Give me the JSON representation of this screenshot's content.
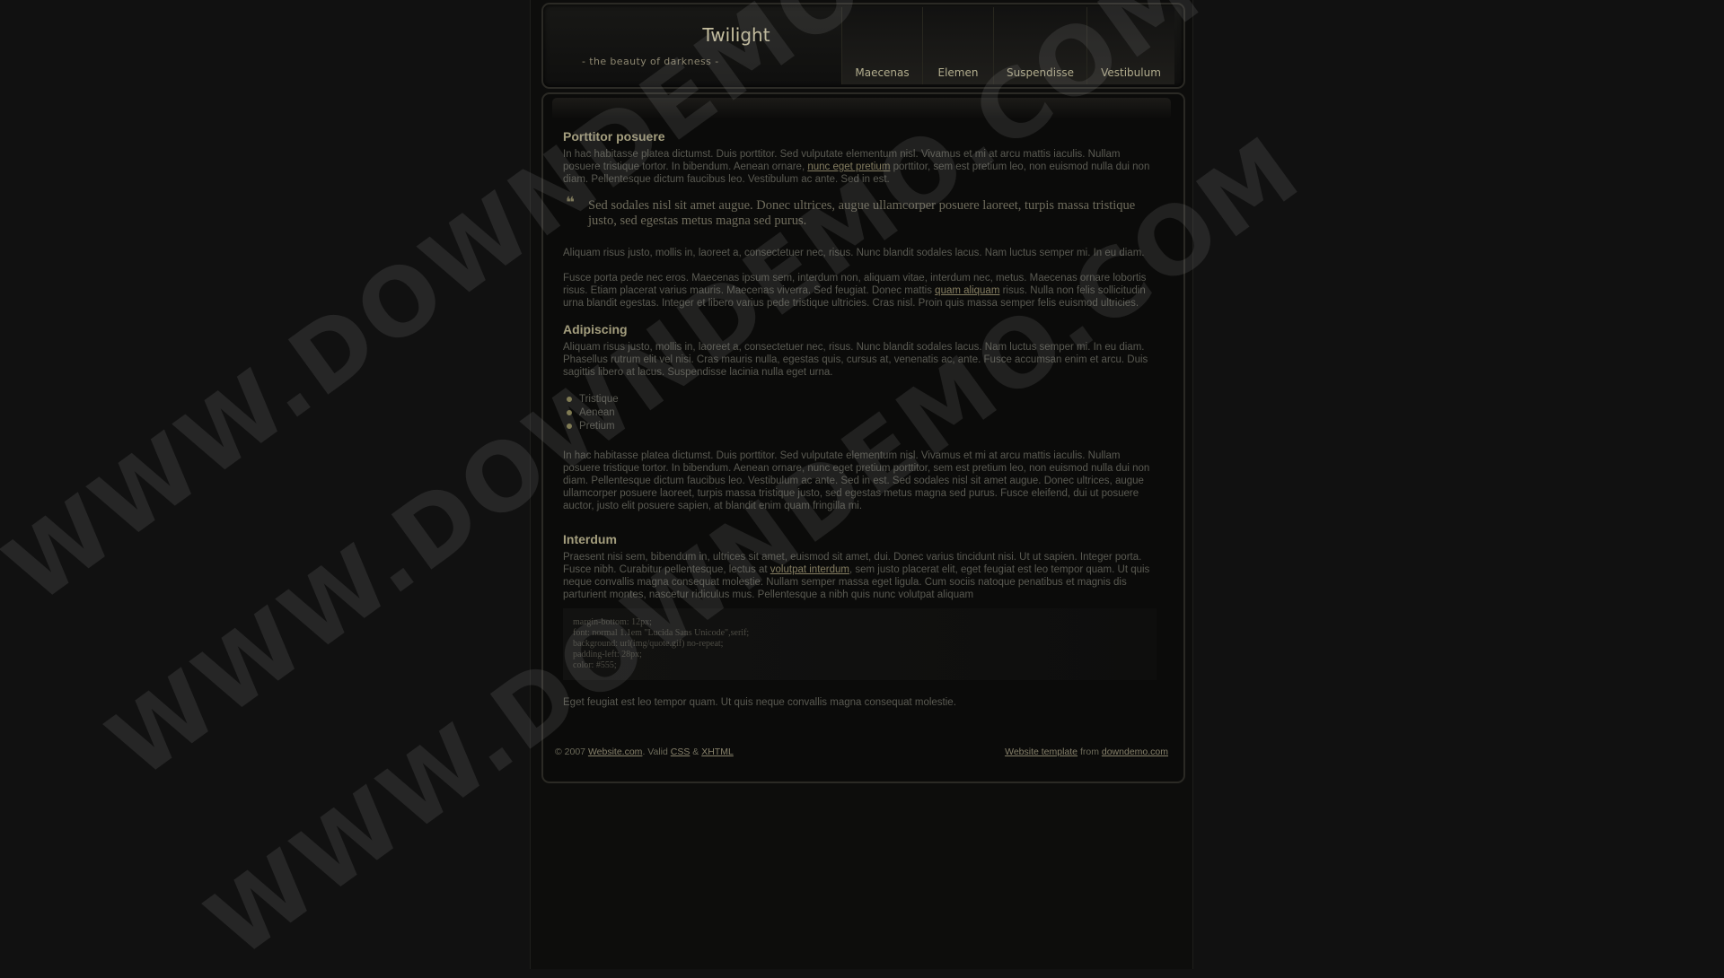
{
  "site": {
    "title": "Twilight",
    "tagline": "- the beauty of darkness -"
  },
  "nav": {
    "items": [
      "Maecenas",
      "Elemen",
      "Suspendisse",
      "Vestibulum"
    ]
  },
  "content": {
    "section1": {
      "heading": "Porttitor posuere",
      "p1_before": "In hac habitasse platea dictumst. Duis porttitor. Sed vulputate elementum nisl. Vivamus et mi at arcu mattis iaculis. Nullam posuere tristique tortor. In bibendum. Aenean ornare, ",
      "p1_link": "nunc eget pretium",
      "p1_after": " porttitor, sem est pretium leo, non euismod nulla dui non diam. Pellentesque dictum faucibus leo. Vestibulum ac ante. Sed in est.",
      "quote": "Sed sodales nisl sit amet augue. Donec ultrices, augue ullamcorper posuere laoreet, turpis massa tristique justo, sed egestas metus magna sed purus.",
      "p2": "Aliquam risus justo, mollis in, laoreet a, consectetuer nec, risus. Nunc blandit sodales lacus. Nam luctus semper mi. In eu diam.",
      "p3_before": "Fusce porta pede nec eros. Maecenas ipsum sem, interdum non, aliquam vitae, interdum nec, metus. Maecenas ornare lobortis risus. Etiam placerat varius mauris. Maecenas viverra. Sed feugiat. Donec mattis ",
      "p3_link": "quam aliquam",
      "p3_after": " risus. Nulla non felis sollicitudin urna blandit egestas. Integer et libero varius pede tristique ultricies. Cras nisl. Proin quis massa semper felis euismod ultricies."
    },
    "section2": {
      "heading": "Adipiscing",
      "p1": "Aliquam risus justo, mollis in, laoreet a, consectetuer nec, risus. Nunc blandit sodales lacus. Nam luctus semper mi. In eu diam. Phasellus rutrum elit vel nisi. Cras mauris nulla, egestas quis, cursus at, venenatis ac, ante. Fusce accumsan enim et arcu. Duis sagittis libero at lacus. Suspendisse lacinia nulla eget urna.",
      "bullets": [
        "Tristique",
        "Aenean",
        "Pretium"
      ],
      "p2": "In hac habitasse platea dictumst. Duis porttitor. Sed vulputate elementum nisl. Vivamus et mi at arcu mattis iaculis. Nullam posuere tristique tortor. In bibendum. Aenean ornare, nunc eget pretium porttitor, sem est pretium leo, non euismod nulla dui non diam. Pellentesque dictum faucibus leo. Vestibulum ac ante. Sed in est. Sed sodales nisl sit amet augue. Donec ultrices, augue ullamcorper posuere laoreet, turpis massa tristique justo, sed egestas metus magna sed purus. Fusce eleifend, dui ut posuere auctor, justo elit posuere sapien, at blandit enim quam fringilla mi."
    },
    "section3": {
      "heading": "Interdum",
      "p1_before": "Praesent nisi sem, bibendum in, ultrices sit amet, euismod sit amet, dui. Donec varius tincidunt nisi. Ut ut sapien. Integer porta. Fusce nibh. Curabitur pellentesque, lectus at ",
      "p1_link": "volutpat interdum",
      "p1_after": ", sem justo placerat elit, eget feugiat est leo tempor quam. Ut quis neque convallis magna consequat molestie. Nullam semper massa eget ligula. Cum sociis natoque penatibus et magnis dis parturient montes, nascetur ridiculus mus. Pellentesque a nibh quis nunc volutpat aliquam",
      "code_lines": [
        "margin-bottom: 12px;",
        "font: normal 1.1em \"Lucida Sans Unicode\",serif;",
        "background: url(img/quote.gif) no-repeat;",
        "padding-left: 28px;",
        "color: #555;"
      ],
      "p2": "Eget feugiat est leo tempor quam. Ut quis neque convallis magna consequat molestie."
    }
  },
  "footer": {
    "copyright": "© 2007",
    "site_link": "Website.com",
    "valid_text": ". Valid",
    "css_link": "CSS",
    "amp": "&",
    "xhtml_link": "XHTML",
    "template_link": "Website template",
    "from_text": "from",
    "source_link": "downdemo.com"
  },
  "watermark": {
    "text": "WWW.DOWNDEMO.COM"
  }
}
